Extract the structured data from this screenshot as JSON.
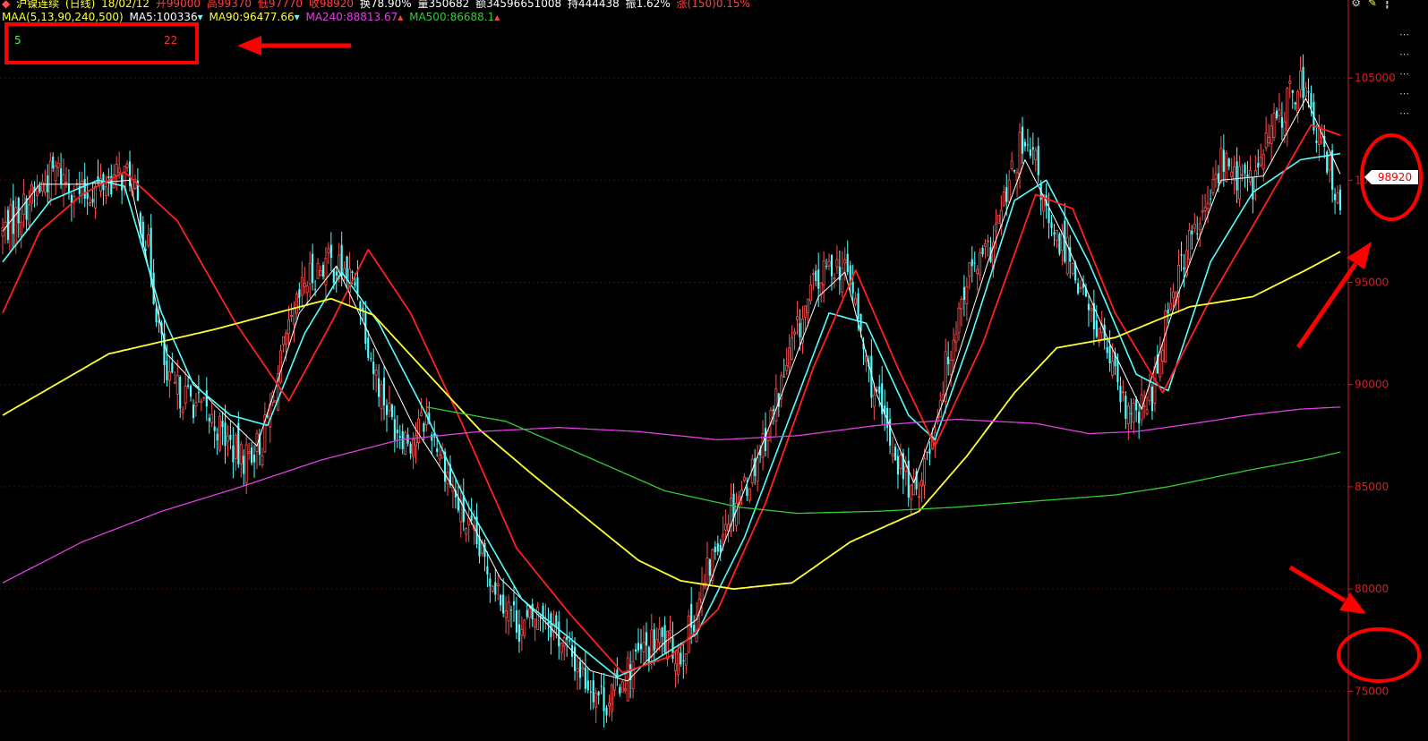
{
  "header": {
    "instrument": "沪镍连续",
    "period": "(日线)",
    "date": "18/02/12",
    "open": "开99000",
    "high": "高99370",
    "low": "低97770",
    "close": "收98920",
    "turnover": "换78.90%",
    "volume": "量350682",
    "amount": "额34596651008",
    "open_interest": "持444438",
    "amplitude": "振1.62%",
    "change": "涨(150)0.15%"
  },
  "ma_legend": {
    "maa": "MAA(5,13,90,240,500)",
    "ma5": "MA5:100336",
    "ma90": "MA90:96477.66",
    "ma240": "MA240:88813.67",
    "ma500": "MA500:86688.1"
  },
  "toolbar": {
    "gear_glyph": "⚙",
    "pen_glyph": "✎",
    "more_glyph": "┇"
  },
  "side_glyphs": [
    "⋯",
    "⋯",
    "⋯",
    "⋯",
    "⋯"
  ],
  "indicator_box": {
    "left_value": "5",
    "right_value": "22"
  },
  "last_price_tag": "98920",
  "colors": {
    "background": "#000000",
    "up_candle": "#ff5050",
    "down_candle": "#54ffff",
    "ma5": "#ffffff",
    "ma13": "#54ffff",
    "ma_red": "#ff2020",
    "ma90": "#ffff33",
    "ma240": "#e040e0",
    "ma500": "#33cc33",
    "axis": "#d02020",
    "annotation": "#ff0000"
  },
  "chart_data": {
    "type": "candlestick",
    "title": "沪镍连续 (日线)",
    "ylim": [
      73000,
      107500
    ],
    "y_ticks": [
      75000,
      80000,
      85000,
      90000,
      95000,
      100000,
      105000
    ],
    "y_tick_labels": [
      "75000",
      "80000",
      "85000",
      "90000",
      "95000",
      "100000",
      "105000"
    ],
    "grid": true,
    "close_anchors": [
      [
        0,
        97500
      ],
      [
        10,
        99000
      ],
      [
        20,
        100500
      ],
      [
        30,
        99200
      ],
      [
        40,
        100000
      ],
      [
        48,
        100300
      ],
      [
        55,
        96500
      ],
      [
        62,
        90000
      ],
      [
        72,
        89200
      ],
      [
        82,
        87800
      ],
      [
        90,
        86300
      ],
      [
        98,
        87200
      ],
      [
        106,
        91500
      ],
      [
        114,
        95000
      ],
      [
        122,
        96000
      ],
      [
        128,
        95600
      ],
      [
        134,
        94800
      ],
      [
        140,
        90800
      ],
      [
        147,
        88200
      ],
      [
        154,
        87300
      ],
      [
        160,
        88400
      ],
      [
        166,
        86500
      ],
      [
        172,
        84000
      ],
      [
        180,
        81800
      ],
      [
        188,
        79800
      ],
      [
        196,
        78000
      ],
      [
        204,
        79000
      ],
      [
        212,
        77300
      ],
      [
        220,
        75600
      ],
      [
        228,
        74500
      ],
      [
        234,
        75700
      ],
      [
        241,
        76800
      ],
      [
        248,
        77500
      ],
      [
        256,
        76800
      ],
      [
        262,
        79000
      ],
      [
        268,
        81500
      ],
      [
        274,
        83800
      ],
      [
        282,
        85500
      ],
      [
        290,
        88300
      ],
      [
        298,
        91800
      ],
      [
        306,
        94700
      ],
      [
        314,
        96000
      ],
      [
        320,
        95200
      ],
      [
        326,
        91000
      ],
      [
        332,
        88300
      ],
      [
        338,
        86300
      ],
      [
        344,
        84500
      ],
      [
        350,
        87000
      ],
      [
        356,
        90800
      ],
      [
        364,
        95300
      ],
      [
        372,
        96300
      ],
      [
        378,
        98800
      ],
      [
        384,
        101500
      ],
      [
        390,
        100800
      ],
      [
        396,
        97000
      ],
      [
        402,
        96800
      ],
      [
        410,
        93500
      ],
      [
        416,
        92200
      ],
      [
        422,
        89000
      ],
      [
        428,
        88300
      ],
      [
        434,
        89500
      ],
      [
        440,
        94000
      ],
      [
        448,
        97000
      ],
      [
        454,
        98300
      ],
      [
        460,
        101000
      ],
      [
        466,
        100200
      ],
      [
        472,
        99800
      ],
      [
        478,
        102200
      ],
      [
        484,
        103500
      ],
      [
        490,
        105000
      ],
      [
        496,
        102400
      ],
      [
        502,
        100200
      ],
      [
        505,
        99000
      ]
    ],
    "series": [
      {
        "name": "MA5",
        "values": [
          [
            0,
            97500
          ],
          [
            14,
            99800
          ],
          [
            30,
            99800
          ],
          [
            48,
            100000
          ],
          [
            62,
            91500
          ],
          [
            80,
            89000
          ],
          [
            96,
            87000
          ],
          [
            112,
            93500
          ],
          [
            126,
            95800
          ],
          [
            140,
            92000
          ],
          [
            155,
            88000
          ],
          [
            170,
            85000
          ],
          [
            188,
            80500
          ],
          [
            204,
            78500
          ],
          [
            222,
            76000
          ],
          [
            236,
            75500
          ],
          [
            250,
            77400
          ],
          [
            262,
            78500
          ],
          [
            276,
            83500
          ],
          [
            292,
            88800
          ],
          [
            308,
            94300
          ],
          [
            318,
            95500
          ],
          [
            330,
            89500
          ],
          [
            344,
            85200
          ],
          [
            356,
            89500
          ],
          [
            372,
            96000
          ],
          [
            386,
            101000
          ],
          [
            400,
            97400
          ],
          [
            418,
            92000
          ],
          [
            430,
            88800
          ],
          [
            444,
            94500
          ],
          [
            460,
            100000
          ],
          [
            476,
            100200
          ],
          [
            492,
            104000
          ],
          [
            505,
            100300
          ]
        ]
      },
      {
        "name": "MA13",
        "values": [
          [
            0,
            96000
          ],
          [
            18,
            99000
          ],
          [
            36,
            100000
          ],
          [
            46,
            99700
          ],
          [
            60,
            93500
          ],
          [
            72,
            90000
          ],
          [
            86,
            88500
          ],
          [
            100,
            88000
          ],
          [
            114,
            92500
          ],
          [
            128,
            95500
          ],
          [
            142,
            93000
          ],
          [
            160,
            88500
          ],
          [
            176,
            84000
          ],
          [
            196,
            79500
          ],
          [
            214,
            77600
          ],
          [
            232,
            75700
          ],
          [
            246,
            76500
          ],
          [
            262,
            77800
          ],
          [
            280,
            82500
          ],
          [
            296,
            88000
          ],
          [
            312,
            93500
          ],
          [
            326,
            93000
          ],
          [
            342,
            88500
          ],
          [
            352,
            87300
          ],
          [
            366,
            92500
          ],
          [
            382,
            99000
          ],
          [
            394,
            100000
          ],
          [
            410,
            96000
          ],
          [
            428,
            90500
          ],
          [
            440,
            89700
          ],
          [
            456,
            96000
          ],
          [
            472,
            99400
          ],
          [
            490,
            101000
          ],
          [
            505,
            101300
          ]
        ]
      },
      {
        "name": "MA (red)",
        "values": [
          [
            0,
            93500
          ],
          [
            14,
            97500
          ],
          [
            30,
            99300
          ],
          [
            46,
            100400
          ],
          [
            66,
            98000
          ],
          [
            88,
            93000
          ],
          [
            108,
            89200
          ],
          [
            124,
            93000
          ],
          [
            138,
            96600
          ],
          [
            154,
            93500
          ],
          [
            172,
            88500
          ],
          [
            194,
            82000
          ],
          [
            214,
            78800
          ],
          [
            234,
            75900
          ],
          [
            252,
            76700
          ],
          [
            270,
            79000
          ],
          [
            288,
            84200
          ],
          [
            306,
            90800
          ],
          [
            322,
            95600
          ],
          [
            338,
            90800
          ],
          [
            352,
            87000
          ],
          [
            370,
            92000
          ],
          [
            390,
            99300
          ],
          [
            404,
            98600
          ],
          [
            420,
            93500
          ],
          [
            438,
            89600
          ],
          [
            456,
            94200
          ],
          [
            474,
            98200
          ],
          [
            494,
            102700
          ],
          [
            505,
            102200
          ]
        ]
      },
      {
        "name": "MA90",
        "values": [
          [
            0,
            88500
          ],
          [
            40,
            91500
          ],
          [
            80,
            92700
          ],
          [
            112,
            93800
          ],
          [
            124,
            94200
          ],
          [
            140,
            93400
          ],
          [
            160,
            90600
          ],
          [
            180,
            87800
          ],
          [
            200,
            85600
          ],
          [
            220,
            83500
          ],
          [
            240,
            81400
          ],
          [
            256,
            80400
          ],
          [
            276,
            80000
          ],
          [
            298,
            80300
          ],
          [
            320,
            82300
          ],
          [
            346,
            83800
          ],
          [
            364,
            86500
          ],
          [
            382,
            89600
          ],
          [
            398,
            91800
          ],
          [
            420,
            92300
          ],
          [
            448,
            93800
          ],
          [
            472,
            94300
          ],
          [
            492,
            95600
          ],
          [
            505,
            96500
          ]
        ]
      },
      {
        "name": "MA240",
        "values": [
          [
            0,
            80300
          ],
          [
            30,
            82300
          ],
          [
            60,
            83800
          ],
          [
            90,
            85000
          ],
          [
            120,
            86300
          ],
          [
            150,
            87300
          ],
          [
            180,
            87700
          ],
          [
            210,
            87900
          ],
          [
            240,
            87700
          ],
          [
            270,
            87300
          ],
          [
            300,
            87500
          ],
          [
            330,
            88000
          ],
          [
            360,
            88300
          ],
          [
            390,
            88100
          ],
          [
            410,
            87600
          ],
          [
            428,
            87700
          ],
          [
            450,
            88100
          ],
          [
            470,
            88500
          ],
          [
            490,
            88800
          ],
          [
            505,
            88900
          ]
        ]
      },
      {
        "name": "MA500",
        "values": [
          [
            160,
            88900
          ],
          [
            190,
            88200
          ],
          [
            220,
            86500
          ],
          [
            250,
            84800
          ],
          [
            278,
            84000
          ],
          [
            300,
            83700
          ],
          [
            330,
            83800
          ],
          [
            360,
            84000
          ],
          [
            390,
            84300
          ],
          [
            420,
            84600
          ],
          [
            440,
            85000
          ],
          [
            470,
            85800
          ],
          [
            495,
            86400
          ],
          [
            505,
            86700
          ]
        ]
      }
    ]
  }
}
